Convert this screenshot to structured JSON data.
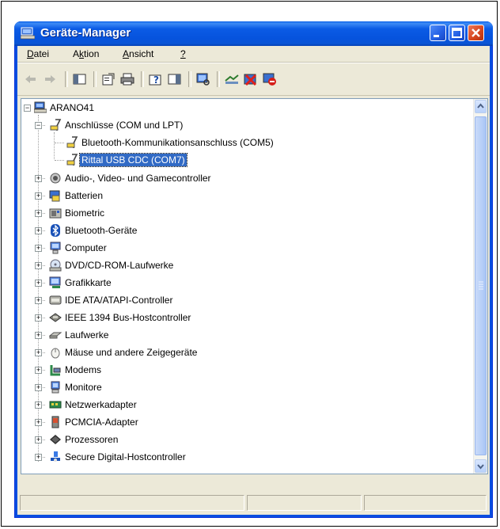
{
  "window": {
    "title": "Geräte-Manager",
    "title_color": "#ffffff",
    "titlebar_color": "#0a55d6",
    "buttons": [
      "minimize-icon",
      "maximize-icon",
      "close-icon"
    ]
  },
  "menu": [
    {
      "label": "Datei",
      "access": "D"
    },
    {
      "label": "Aktion",
      "access": "k"
    },
    {
      "label": "Ansicht",
      "access": "A"
    },
    {
      "label": "?",
      "access": "?"
    }
  ],
  "toolbar": {
    "buttons": [
      "back-arrow-icon",
      "forward-arrow-icon",
      "show-hide-console-tree-icon",
      "properties-icon",
      "print-icon",
      "help-icon",
      "show-hide-action-pane-icon",
      "scan-hardware-icon",
      "update-driver-icon",
      "uninstall-icon",
      "disable-icon"
    ]
  },
  "tree": {
    "root": "ARANO41",
    "nodes": [
      {
        "label": "Anschlüsse (COM und LPT)",
        "icon": "port-icon",
        "expanded": true,
        "children": [
          {
            "label": "Bluetooth-Kommunikationsanschluss (COM5)",
            "icon": "port-icon"
          },
          {
            "label": "Rittal USB CDC (COM7)",
            "icon": "port-icon",
            "selected": true
          }
        ]
      },
      {
        "label": "Audio-, Video- und Gamecontroller",
        "icon": "speaker-icon"
      },
      {
        "label": "Batterien",
        "icon": "battery-icon"
      },
      {
        "label": "Biometric",
        "icon": "biometric-icon"
      },
      {
        "label": "Bluetooth-Geräte",
        "icon": "bluetooth-icon"
      },
      {
        "label": "Computer",
        "icon": "computer-icon"
      },
      {
        "label": "DVD/CD-ROM-Laufwerke",
        "icon": "cd-drive-icon"
      },
      {
        "label": "Grafikkarte",
        "icon": "display-adapter-icon"
      },
      {
        "label": "IDE ATA/ATAPI-Controller",
        "icon": "ide-controller-icon"
      },
      {
        "label": "IEEE 1394 Bus-Hostcontroller",
        "icon": "firewire-icon"
      },
      {
        "label": "Laufwerke",
        "icon": "disk-drive-icon"
      },
      {
        "label": "Mäuse und andere Zeigegeräte",
        "icon": "mouse-icon"
      },
      {
        "label": "Modems",
        "icon": "modem-icon"
      },
      {
        "label": "Monitore",
        "icon": "monitor-icon"
      },
      {
        "label": "Netzwerkadapter",
        "icon": "network-adapter-icon"
      },
      {
        "label": "PCMCIA-Adapter",
        "icon": "pcmcia-icon"
      },
      {
        "label": "Prozessoren",
        "icon": "processor-icon"
      },
      {
        "label": "Secure Digital-Hostcontroller",
        "icon": "sd-host-icon"
      }
    ]
  },
  "colors": {
    "selection": "#316ac5",
    "window_bg": "#ece9d8"
  }
}
